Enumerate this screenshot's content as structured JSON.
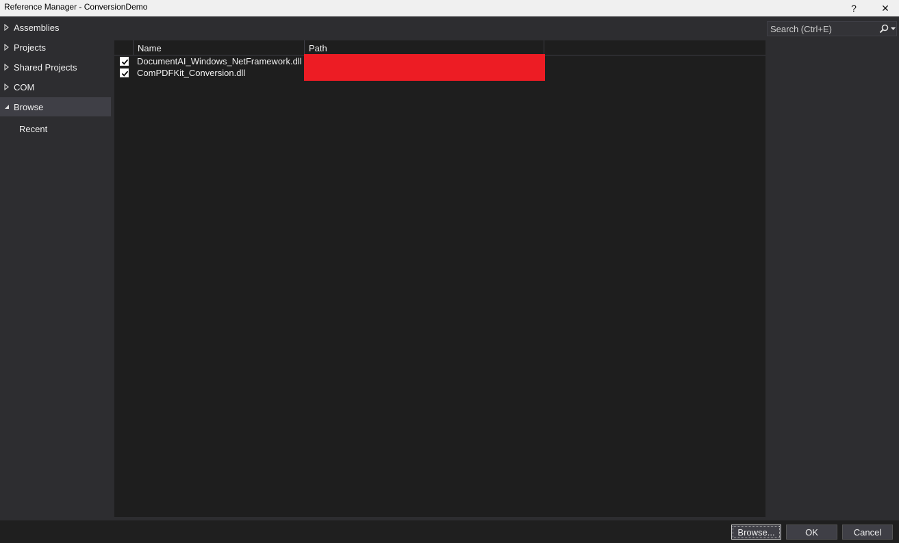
{
  "window": {
    "title": "Reference Manager - ConversionDemo",
    "help_label": "?",
    "close_label": "✕"
  },
  "nav": {
    "items": [
      {
        "label": "Assemblies",
        "expanded": false
      },
      {
        "label": "Projects",
        "expanded": false
      },
      {
        "label": "Shared Projects",
        "expanded": false
      },
      {
        "label": "COM",
        "expanded": false
      },
      {
        "label": "Browse",
        "expanded": true,
        "selected": true
      }
    ],
    "sub_items": [
      {
        "label": "Recent"
      }
    ]
  },
  "list": {
    "columns": [
      "Name",
      "Path"
    ],
    "rows": [
      {
        "checked": true,
        "name": "DocumentAI_Windows_NetFramework.dll"
      },
      {
        "checked": true,
        "name": "ComPDFKit_Conversion.dll"
      }
    ]
  },
  "search": {
    "placeholder": "Search (Ctrl+E)",
    "icon": "search-icon"
  },
  "buttons": {
    "browse": "Browse...",
    "ok": "OK",
    "cancel": "Cancel"
  },
  "colors": {
    "redaction": "#ed1c24",
    "background": "#2d2d30",
    "list_background": "#1e1e1e"
  }
}
